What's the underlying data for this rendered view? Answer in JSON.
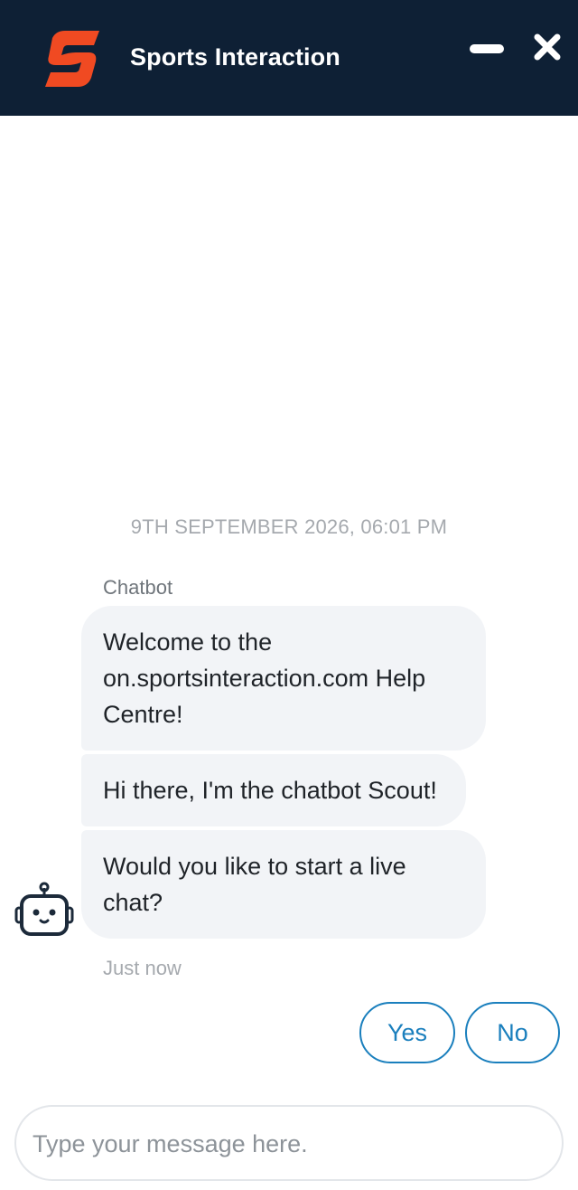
{
  "header": {
    "title": "Sports Interaction",
    "logo_icon": "sports-interaction-logo",
    "minimize_icon": "minimize-icon",
    "close_icon": "close-icon",
    "background_color": "#0e2035",
    "logo_color": "#f04a22"
  },
  "conversation": {
    "date_divider": "9TH SEPTEMBER 2026, 06:01 PM",
    "sender_name": "Chatbot",
    "messages": [
      "Welcome to the on.sportsinteraction.com Help Centre!",
      "Hi there, I'm the chatbot Scout!",
      "Would you like to start a live chat?"
    ],
    "status_time": "Just now",
    "avatar_icon": "robot-icon"
  },
  "quick_replies": [
    {
      "label": "Yes"
    },
    {
      "label": "No"
    }
  ],
  "composer": {
    "value": "",
    "placeholder": "Type your message here."
  },
  "colors": {
    "accent": "#1a7fbd",
    "bubble_background": "#f2f4f7"
  }
}
